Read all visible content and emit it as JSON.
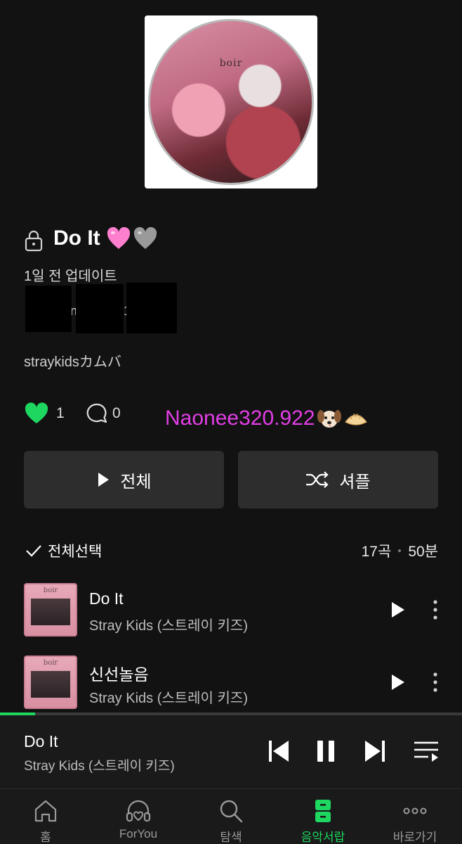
{
  "playlist": {
    "title": "Do It",
    "updated": "1일 전 업데이트",
    "owner_fragment_1": "n",
    "owner_fragment_2": "1",
    "description": "straykidsカムバ",
    "likes": "1",
    "comments": "0",
    "watermark": "Naonee320.922"
  },
  "actions": {
    "play_all": "전체",
    "shuffle": "셔플"
  },
  "list_header": {
    "select_all": "전체선택",
    "track_count": "17곡",
    "duration": "50분"
  },
  "cover_logo": "boir",
  "tracks": [
    {
      "title": "Do It",
      "artist": "Stray Kids (스트레이 키즈)"
    },
    {
      "title": "신선놀음",
      "artist": "Stray Kids (스트레이 키즈)"
    }
  ],
  "now_playing": {
    "title": "Do It",
    "artist": "Stray Kids (스트레이 키즈)",
    "progress": 0.076
  },
  "bottom_nav": [
    {
      "label": "홈",
      "icon": "home-icon"
    },
    {
      "label": "ForYou",
      "icon": "headphones-heart-icon"
    },
    {
      "label": "탐색",
      "icon": "search-icon"
    },
    {
      "label": "음악서랍",
      "icon": "drawer-icon",
      "active": true
    },
    {
      "label": "바로가기",
      "icon": "more-dots-icon"
    }
  ],
  "colors": {
    "accent": "#1ed760",
    "background": "#121212",
    "button": "#2d2d2d",
    "watermark": "#e23ee6"
  }
}
